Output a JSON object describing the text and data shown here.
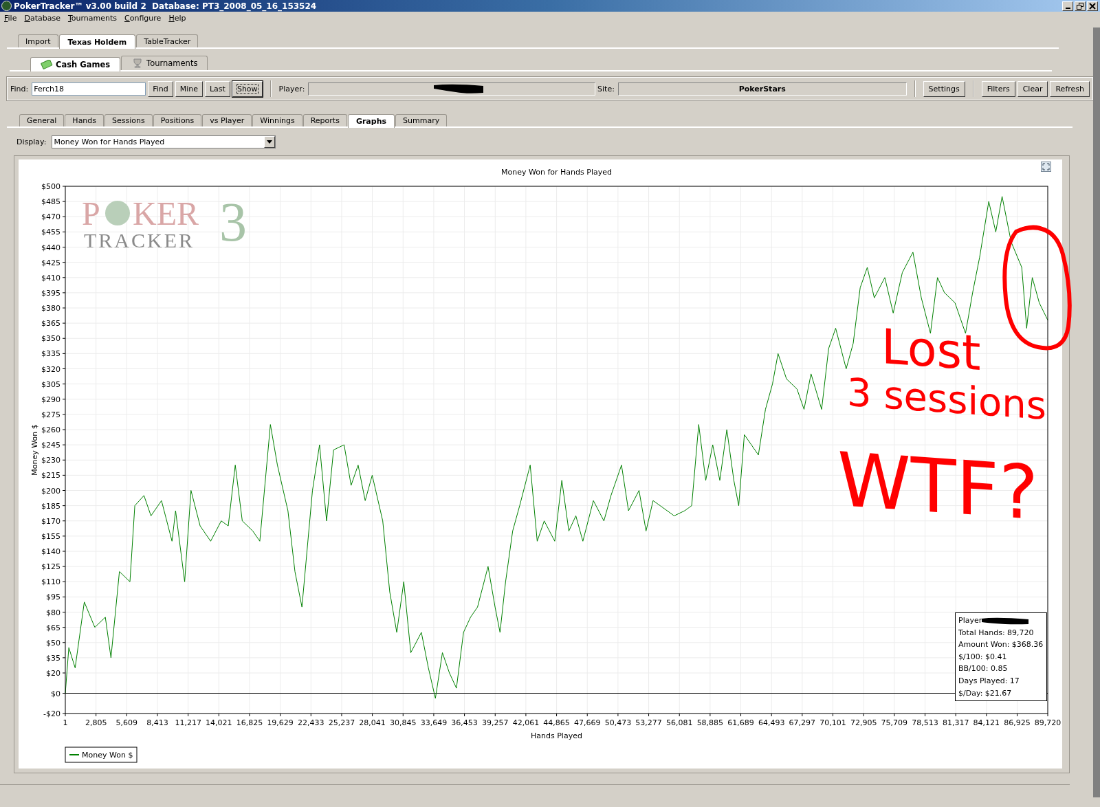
{
  "window": {
    "title": "PokerTracker™ v3.00 build 2  Database: PT3_2008_05_16_153524"
  },
  "menu": [
    "File",
    "Database",
    "Tournaments",
    "Configure",
    "Help"
  ],
  "main_tabs": [
    {
      "label": "Import",
      "selected": false
    },
    {
      "label": "Texas Holdem",
      "selected": true
    },
    {
      "label": "TableTracker",
      "selected": false
    }
  ],
  "game_tabs": [
    {
      "label": "Cash Games",
      "selected": true,
      "kind": "money"
    },
    {
      "label": "Tournaments",
      "selected": false,
      "kind": "trophy"
    }
  ],
  "toolbar": {
    "find_label": "Find:",
    "find_value": "Ferch18",
    "buttons": [
      {
        "label": "Find",
        "focused": false
      },
      {
        "label": "Mine",
        "focused": false
      },
      {
        "label": "Last",
        "focused": false
      },
      {
        "label": "Show",
        "focused": true
      }
    ],
    "player_label": "Player:",
    "site_label": "Site:",
    "site_value": "PokerStars",
    "settings": "Settings",
    "right_buttons": [
      "Filters",
      "Clear",
      "Refresh"
    ]
  },
  "view_tabs": [
    {
      "label": "General",
      "selected": false
    },
    {
      "label": "Hands",
      "selected": false
    },
    {
      "label": "Sessions",
      "selected": false
    },
    {
      "label": "Positions",
      "selected": false
    },
    {
      "label": "vs Player",
      "selected": false
    },
    {
      "label": "Winnings",
      "selected": false
    },
    {
      "label": "Reports",
      "selected": false
    },
    {
      "label": "Graphs",
      "selected": true
    },
    {
      "label": "Summary",
      "selected": false
    }
  ],
  "display": {
    "label": "Display:",
    "value": "Money Won for Hands Played"
  },
  "chart": {
    "watermark": {
      "first": "P",
      "rest": "KER",
      "digit": "3",
      "second_line": "TRACKER"
    },
    "stats": {
      "player_label": "Player",
      "lines": [
        "Total Hands: 89,720",
        "Amount Won: $368.36",
        "$/100: $0.41",
        "BB/100: 0.85",
        "Days Played: 17",
        "$/Day: $21.67"
      ]
    },
    "chart_data": {
      "type": "line",
      "title": "Money Won for Hands Played",
      "xlabel": "Hands Played",
      "ylabel": "Money Won $",
      "x": [
        1,
        322,
        899,
        1732,
        2694,
        3656,
        4169,
        4939,
        5900,
        6349,
        7183,
        7824,
        8786,
        9748,
        10069,
        10903,
        11480,
        12314,
        13276,
        14238,
        14879,
        15520,
        16162,
        17124,
        17765,
        18727,
        19368,
        20330,
        20972,
        21613,
        22575,
        23216,
        23858,
        24499,
        25461,
        26102,
        26743,
        27385,
        28026,
        28988,
        29630,
        30271,
        30912,
        31553,
        32515,
        33157,
        33798,
        34439,
        35080,
        35722,
        36363,
        37004,
        37646,
        38608,
        39249,
        39698,
        40211,
        40852,
        41493,
        42455,
        43097,
        43738,
        44700,
        45341,
        45982,
        46623,
        47265,
        48227,
        49189,
        49830,
        50792,
        51433,
        52395,
        53036,
        53678,
        54319,
        55601,
        56563,
        57205,
        57846,
        58487,
        59128,
        59770,
        60411,
        61052,
        61501,
        62014,
        62655,
        63297,
        63938,
        64579,
        65092,
        65862,
        66824,
        67465,
        68106,
        69068,
        69709,
        70351,
        71313,
        71954,
        72595,
        73237,
        73878,
        74840,
        75609,
        76443,
        77405,
        78174,
        79008,
        79649,
        80290,
        81252,
        82214,
        82856,
        83497,
        84331,
        84972,
        85549,
        86383,
        87345,
        87794,
        88307,
        88948,
        89720
      ],
      "series": [
        {
          "name": "Money Won $",
          "color": "#008000",
          "values": [
            0,
            45,
            25,
            90,
            65,
            75,
            35,
            120,
            110,
            185,
            195,
            175,
            190,
            150,
            180,
            110,
            200,
            165,
            150,
            170,
            165,
            225,
            170,
            160,
            150,
            265,
            225,
            180,
            120,
            85,
            200,
            245,
            170,
            240,
            245,
            205,
            225,
            190,
            215,
            170,
            100,
            60,
            110,
            40,
            60,
            25,
            -5,
            40,
            20,
            5,
            60,
            75,
            85,
            125,
            85,
            60,
            110,
            160,
            185,
            225,
            150,
            170,
            150,
            210,
            160,
            175,
            150,
            190,
            170,
            195,
            225,
            180,
            200,
            160,
            190,
            185,
            175,
            180,
            185,
            265,
            210,
            245,
            210,
            260,
            210,
            185,
            255,
            245,
            235,
            280,
            305,
            335,
            310,
            300,
            280,
            315,
            280,
            340,
            360,
            320,
            345,
            400,
            420,
            390,
            410,
            375,
            415,
            435,
            390,
            355,
            410,
            395,
            385,
            355,
            395,
            430,
            485,
            455,
            490,
            445,
            420,
            360,
            410,
            385,
            368
          ]
        }
      ],
      "xlim": [
        1,
        89720
      ],
      "ylim": [
        -20,
        500
      ],
      "grid": true,
      "xticks": [
        {
          "value": 1,
          "label": "1"
        },
        {
          "value": 2805,
          "label": "2,805"
        },
        {
          "value": 5609,
          "label": "5,609"
        },
        {
          "value": 8413,
          "label": "8,413"
        },
        {
          "value": 11217,
          "label": "11,217"
        },
        {
          "value": 14021,
          "label": "14,021"
        },
        {
          "value": 16825,
          "label": "16,825"
        },
        {
          "value": 19629,
          "label": "19,629"
        },
        {
          "value": 22433,
          "label": "22,433"
        },
        {
          "value": 25237,
          "label": "25,237"
        },
        {
          "value": 28041,
          "label": "28,041"
        },
        {
          "value": 30845,
          "label": "30,845"
        },
        {
          "value": 33649,
          "label": "33,649"
        },
        {
          "value": 36453,
          "label": "36,453"
        },
        {
          "value": 39257,
          "label": "39,257"
        },
        {
          "value": 42061,
          "label": "42,061"
        },
        {
          "value": 44865,
          "label": "44,865"
        },
        {
          "value": 47669,
          "label": "47,669"
        },
        {
          "value": 50473,
          "label": "50,473"
        },
        {
          "value": 53277,
          "label": "53,277"
        },
        {
          "value": 56081,
          "label": "56,081"
        },
        {
          "value": 58885,
          "label": "58,885"
        },
        {
          "value": 61689,
          "label": "61,689"
        },
        {
          "value": 64493,
          "label": "64,493"
        },
        {
          "value": 67297,
          "label": "67,297"
        },
        {
          "value": 70101,
          "label": "70,101"
        },
        {
          "value": 72905,
          "label": "72,905"
        },
        {
          "value": 75709,
          "label": "75,709"
        },
        {
          "value": 78513,
          "label": "78,513"
        },
        {
          "value": 81317,
          "label": "81,317"
        },
        {
          "value": 84121,
          "label": "84,121"
        },
        {
          "value": 86925,
          "label": "86,925"
        },
        {
          "value": 89720,
          "label": "89,720"
        }
      ],
      "yticks": [
        {
          "value": 500,
          "label": "$500"
        },
        {
          "value": 485,
          "label": "$485"
        },
        {
          "value": 470,
          "label": "$470"
        },
        {
          "value": 455,
          "label": "$455"
        },
        {
          "value": 440,
          "label": "$440"
        },
        {
          "value": 425,
          "label": "$425"
        },
        {
          "value": 410,
          "label": "$410"
        },
        {
          "value": 395,
          "label": "$395"
        },
        {
          "value": 380,
          "label": "$380"
        },
        {
          "value": 365,
          "label": "$365"
        },
        {
          "value": 350,
          "label": "$350"
        },
        {
          "value": 335,
          "label": "$335"
        },
        {
          "value": 320,
          "label": "$320"
        },
        {
          "value": 305,
          "label": "$305"
        },
        {
          "value": 290,
          "label": "$290"
        },
        {
          "value": 275,
          "label": "$275"
        },
        {
          "value": 260,
          "label": "$260"
        },
        {
          "value": 245,
          "label": "$245"
        },
        {
          "value": 230,
          "label": "$230"
        },
        {
          "value": 215,
          "label": "$215"
        },
        {
          "value": 200,
          "label": "$200"
        },
        {
          "value": 185,
          "label": "$185"
        },
        {
          "value": 170,
          "label": "$170"
        },
        {
          "value": 155,
          "label": "$155"
        },
        {
          "value": 140,
          "label": "$140"
        },
        {
          "value": 125,
          "label": "$125"
        },
        {
          "value": 110,
          "label": "$110"
        },
        {
          "value": 95,
          "label": "$95"
        },
        {
          "value": 80,
          "label": "$80"
        },
        {
          "value": 65,
          "label": "$65"
        },
        {
          "value": 50,
          "label": "$50"
        },
        {
          "value": 35,
          "label": "$35"
        },
        {
          "value": 20,
          "label": "$20"
        },
        {
          "value": 0,
          "label": "$0"
        },
        {
          "value": -20,
          "label": "-$20"
        }
      ]
    }
  },
  "annotation": {
    "lines": [
      "Lost",
      "3 sessions",
      "WTF?"
    ]
  }
}
